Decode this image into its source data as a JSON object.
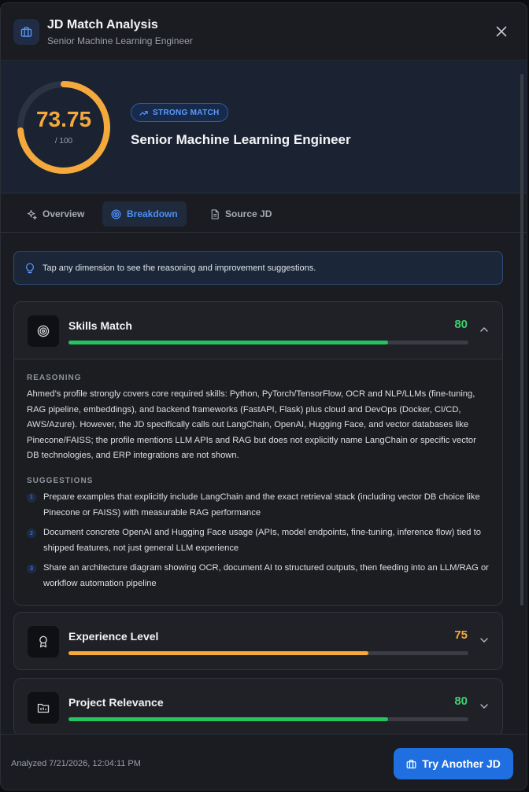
{
  "header": {
    "title": "JD Match Analysis",
    "subtitle": "Senior Machine Learning Engineer",
    "icon": "briefcase-icon"
  },
  "score": {
    "value": "73.75",
    "max_label": "/ 100",
    "fraction": 0.7375,
    "badge": "STRONG MATCH",
    "title": "Senior Machine Learning Engineer",
    "color": "#f5a93a"
  },
  "tabs": [
    {
      "label": "Overview",
      "icon": "sparkle-icon",
      "active": false
    },
    {
      "label": "Breakdown",
      "icon": "target-icon",
      "active": true
    },
    {
      "label": "Source JD",
      "icon": "document-icon",
      "active": false
    }
  ],
  "hint": "Tap any dimension to see the reasoning and improvement suggestions.",
  "dimensions": [
    {
      "name": "Skills Match",
      "score": "80",
      "fraction": 0.8,
      "color": "#22c55e",
      "score_color": "#3ecf6e",
      "icon": "target-icon",
      "expanded": true,
      "reasoning_label": "REASONING",
      "reasoning": "Ahmed’s profile strongly covers core required skills: Python, PyTorch/TensorFlow, OCR and NLP/LLMs (fine-tuning, RAG pipeline, embeddings), and backend frameworks (FastAPI, Flask) plus cloud and DevOps (Docker, CI/CD, AWS/Azure). However, the JD specifically calls out LangChain, OpenAI, Hugging Face, and vector databases like Pinecone/FAISS; the profile mentions LLM APIs and RAG but does not explicitly name LangChain or specific vector DB technologies, and ERP integrations are not shown.",
      "suggestions_label": "SUGGESTIONS",
      "suggestions": [
        {
          "num": "1",
          "text": "Prepare examples that explicitly include LangChain and the exact retrieval stack (including vector DB choice like Pinecone or FAISS) with measurable RAG performance"
        },
        {
          "num": "2",
          "text": "Document concrete OpenAI and Hugging Face usage (APIs, model endpoints, fine-tuning, inference flow) tied to shipped features, not just general LLM experience"
        },
        {
          "num": "3",
          "text": "Share an architecture diagram showing OCR, document AI to structured outputs, then feeding into an LLM/RAG or workflow automation pipeline"
        }
      ]
    },
    {
      "name": "Experience Level",
      "score": "75",
      "fraction": 0.75,
      "color": "#f5a93a",
      "score_color": "#f5a93a",
      "icon": "award-icon",
      "expanded": false
    },
    {
      "name": "Project Relevance",
      "score": "80",
      "fraction": 0.8,
      "color": "#22c55e",
      "score_color": "#3ecf6e",
      "icon": "folder-icon",
      "expanded": false
    }
  ],
  "footer": {
    "analyzed": "Analyzed 7/21/2026, 12:04:11 PM",
    "button_label": "Try Another JD"
  }
}
